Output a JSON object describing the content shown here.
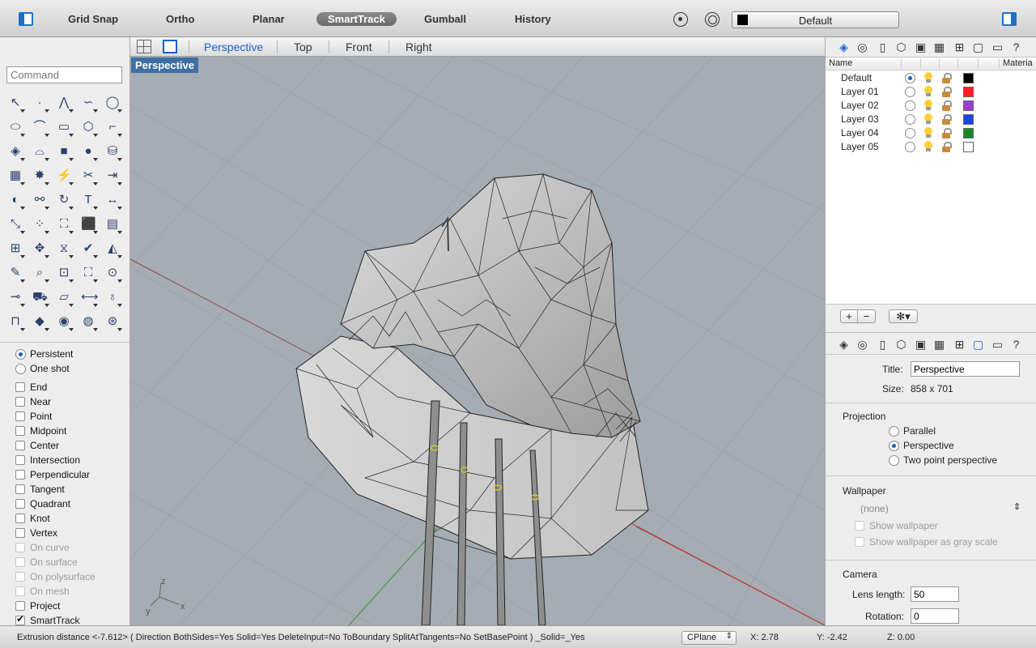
{
  "toolbar": {
    "items": [
      "Grid Snap",
      "Ortho",
      "Planar",
      "SmartTrack",
      "Gumball",
      "History"
    ],
    "active": "SmartTrack",
    "layer_dropdown": "Default",
    "layer_swatch_color": "#000000"
  },
  "command": {
    "placeholder": "Command"
  },
  "tools": [
    "select-arrow-icon",
    "point-icon",
    "polyline-icon",
    "curve-icon",
    "circle-icon",
    "ellipse-icon",
    "arc-icon",
    "rectangle-icon",
    "polygon-icon",
    "fillet-icon",
    "surface-icon",
    "sweep-icon",
    "box-icon",
    "sphere-icon",
    "cylinder-icon",
    "patch-icon",
    "explode-icon",
    "split-icon",
    "trim-icon",
    "extend-icon",
    "boolean-icon",
    "join-icon",
    "rotate-icon",
    "text-icon",
    "dimension-icon",
    "transform-icon",
    "array-icon",
    "group-icon",
    "block-icon",
    "hatch-icon",
    "grid-icon",
    "gumball-icon",
    "mirror-icon",
    "check-icon",
    "analyze-icon",
    "paint-icon",
    "zoom-icon",
    "zoom-window-icon",
    "zoom-extents-icon",
    "zoom-selected-icon",
    "camera-icon",
    "car-icon",
    "ground-plane-icon",
    "distance-icon",
    "light-icon",
    "lock-icon",
    "material-icon",
    "color-wheel-icon",
    "sphere-render-icon",
    "render-icon"
  ],
  "osnap": {
    "mode": [
      {
        "label": "Persistent",
        "checked": true
      },
      {
        "label": "One shot",
        "checked": false
      }
    ],
    "items": [
      {
        "label": "End",
        "checked": false,
        "disabled": false
      },
      {
        "label": "Near",
        "checked": false,
        "disabled": false
      },
      {
        "label": "Point",
        "checked": false,
        "disabled": false
      },
      {
        "label": "Midpoint",
        "checked": false,
        "disabled": false
      },
      {
        "label": "Center",
        "checked": false,
        "disabled": false
      },
      {
        "label": "Intersection",
        "checked": false,
        "disabled": false
      },
      {
        "label": "Perpendicular",
        "checked": false,
        "disabled": false
      },
      {
        "label": "Tangent",
        "checked": false,
        "disabled": false
      },
      {
        "label": "Quadrant",
        "checked": false,
        "disabled": false
      },
      {
        "label": "Knot",
        "checked": false,
        "disabled": false
      },
      {
        "label": "Vertex",
        "checked": false,
        "disabled": false
      },
      {
        "label": "On curve",
        "checked": false,
        "disabled": true
      },
      {
        "label": "On surface",
        "checked": false,
        "disabled": true
      },
      {
        "label": "On polysurface",
        "checked": false,
        "disabled": true
      },
      {
        "label": "On mesh",
        "checked": false,
        "disabled": true
      },
      {
        "label": "Project",
        "checked": false,
        "disabled": false
      },
      {
        "label": "SmartTrack",
        "checked": true,
        "disabled": false
      }
    ]
  },
  "viewtabs": {
    "tabs": [
      "Perspective",
      "Top",
      "Front",
      "Right"
    ],
    "active": "Perspective"
  },
  "viewport": {
    "label": "Perspective",
    "axis_x": "x",
    "axis_y": "y",
    "axis_z": "z"
  },
  "layers": {
    "columns": {
      "name": "Name",
      "material": "Materia"
    },
    "rows": [
      {
        "name": "Default",
        "current": true,
        "color": "#000000"
      },
      {
        "name": "Layer 01",
        "current": false,
        "color": "#ff2020"
      },
      {
        "name": "Layer 02",
        "current": false,
        "color": "#9b3fd6"
      },
      {
        "name": "Layer 03",
        "current": false,
        "color": "#1744e8"
      },
      {
        "name": "Layer 04",
        "current": false,
        "color": "#168a2a"
      },
      {
        "name": "Layer 05",
        "current": false,
        "color": "#ffffff"
      }
    ],
    "add_label": "+",
    "remove_label": "−",
    "gear_label": "✻▾"
  },
  "properties": {
    "title_label": "Title:",
    "title_value": "Perspective",
    "size_label": "Size:",
    "size_value": "858 x 701",
    "projection": {
      "heading": "Projection",
      "options": [
        {
          "label": "Parallel",
          "checked": false
        },
        {
          "label": "Perspective",
          "checked": true
        },
        {
          "label": "Two point perspective",
          "checked": false
        }
      ]
    },
    "wallpaper": {
      "heading": "Wallpaper",
      "value": "(none)",
      "show_label": "Show wallpaper",
      "gray_label": "Show wallpaper as gray scale"
    },
    "camera": {
      "heading": "Camera",
      "lens_label": "Lens length:",
      "lens_value": "50",
      "rotation_label": "Rotation:",
      "rotation_value": "0"
    }
  },
  "status": {
    "command_text": "Extrusion distance <-7.612> ( Direction BothSides=Yes Solid=Yes DeleteInput=No ToBoundary SplitAtTangents=No SetBasePoint ) _Solid=_Yes",
    "cplane": "CPlane",
    "x": "X: 2.78",
    "y": "Y: -2.42",
    "z": "Z: 0.00"
  }
}
